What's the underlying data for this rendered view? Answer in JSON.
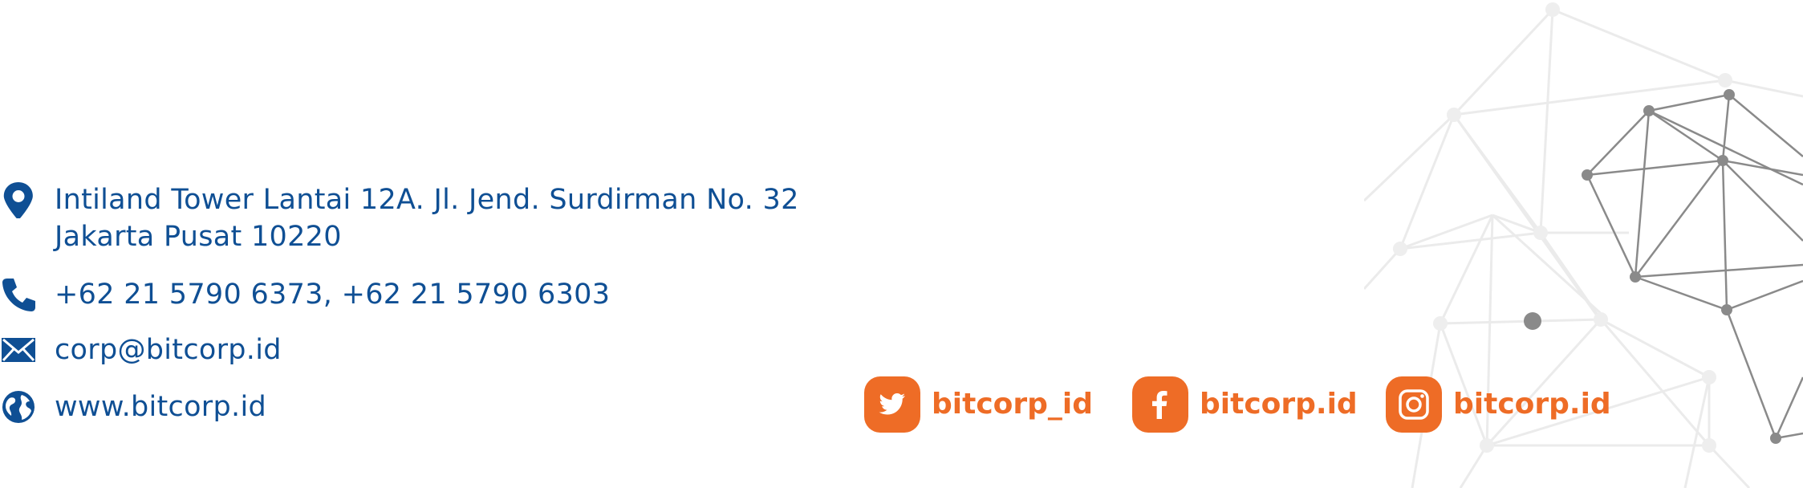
{
  "contact": {
    "address_line1": "Intiland Tower Lantai 12A.  Jl. Jend. Surdirman No. 32",
    "address_line2": "Jakarta Pusat 10220",
    "phone": "+62 21 5790 6373, +62 21 5790 6303",
    "email": "corp@bitcorp.id",
    "website": "www.bitcorp.id"
  },
  "social": {
    "twitter": {
      "handle": "bitcorp_id",
      "icon": "twitter-icon"
    },
    "facebook": {
      "handle": "bitcorp.id",
      "icon": "facebook-icon"
    },
    "instagram": {
      "handle": "bitcorp.id",
      "icon": "instagram-icon"
    }
  },
  "colors": {
    "text_blue": "#0f4f94",
    "social_orange": "#ee6c26",
    "network_dark": "#8a8a8a",
    "network_light": "#eeeeee"
  },
  "icons": [
    "location-pin-icon",
    "phone-icon",
    "mail-icon",
    "globe-icon"
  ]
}
